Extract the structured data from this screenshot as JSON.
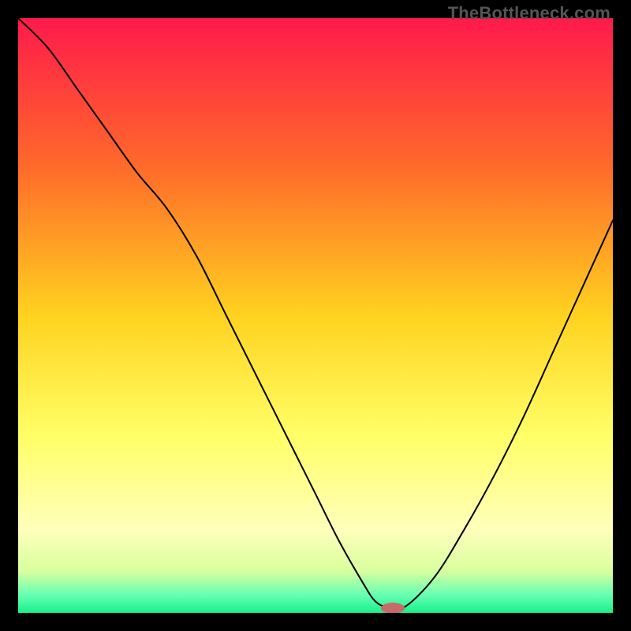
{
  "watermark": "TheBottleneck.com",
  "chart_data": {
    "type": "line",
    "title": "",
    "xlabel": "",
    "ylabel": "",
    "xlim": [
      0,
      100
    ],
    "ylim": [
      0,
      100
    ],
    "gradient_stops": [
      {
        "offset": 0,
        "color": "#ff1a4b"
      },
      {
        "offset": 25,
        "color": "#ff6a2a"
      },
      {
        "offset": 50,
        "color": "#ffd21f"
      },
      {
        "offset": 70,
        "color": "#ffff66"
      },
      {
        "offset": 86,
        "color": "#ffffbb"
      },
      {
        "offset": 93,
        "color": "#d8ff9e"
      },
      {
        "offset": 97,
        "color": "#66ffb3"
      },
      {
        "offset": 100,
        "color": "#18f08a"
      }
    ],
    "series": [
      {
        "name": "bottleneck-curve",
        "x": [
          0,
          5,
          10,
          15,
          20,
          25,
          30,
          35,
          40,
          45,
          50,
          54,
          58,
          60,
          62,
          65,
          70,
          75,
          80,
          85,
          90,
          95,
          100
        ],
        "y": [
          100,
          95,
          88,
          81,
          74,
          68,
          60,
          50,
          40,
          30,
          20,
          12,
          5,
          2,
          1,
          1,
          6,
          14,
          23,
          33,
          44,
          55,
          66
        ]
      }
    ],
    "marker": {
      "x": 63,
      "y": 0.8,
      "color": "#c96a6a",
      "rx": 2.0,
      "ry": 0.9
    },
    "annotations": []
  }
}
